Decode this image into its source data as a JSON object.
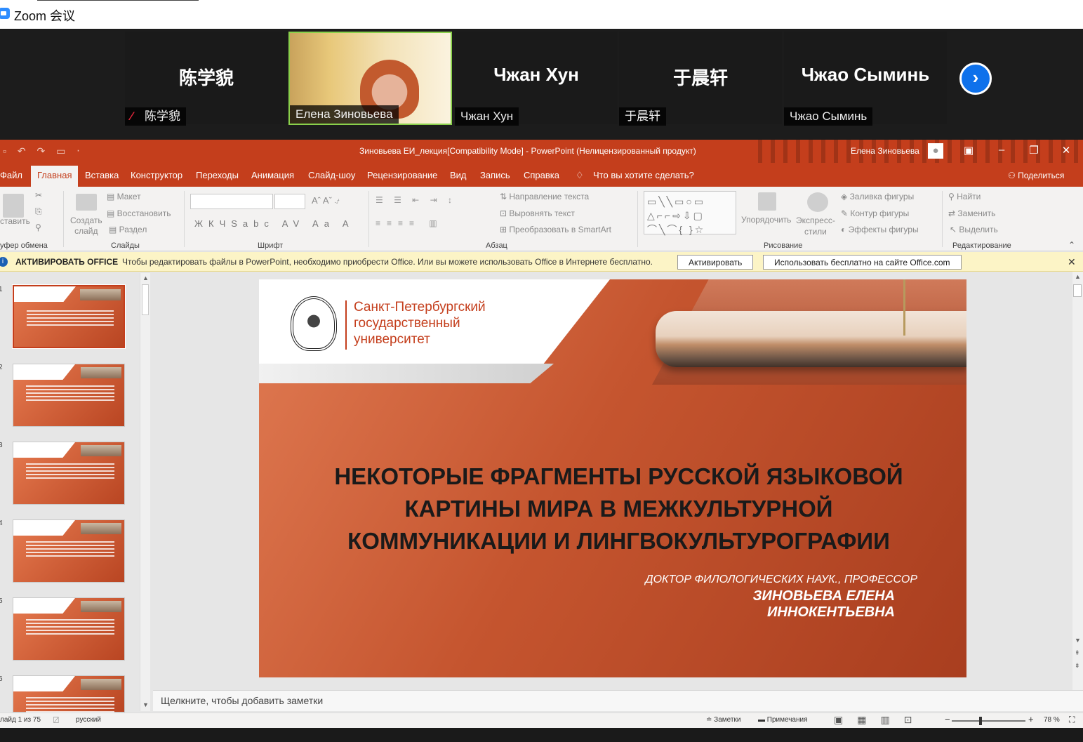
{
  "zoom": {
    "title": "Zoom 会议",
    "participants": [
      {
        "big": "陈学貌",
        "name": "陈学貌",
        "muted": true
      },
      {
        "big": "",
        "name": "Елена Зиновьева",
        "video": true
      },
      {
        "big": "Чжан Хун",
        "name": "Чжан Хун"
      },
      {
        "big": "于晨轩",
        "name": "于晨轩"
      },
      {
        "big": "Чжао Сыминь",
        "name": "Чжао Сыминь"
      }
    ],
    "next_icon": "›"
  },
  "ppt": {
    "doc_title": "Зиновьева ЕИ_лекция[Compatibility Mode]  -  PowerPoint (Нелицензированный продукт)",
    "user": "Елена Зиновьева",
    "tabs": [
      "Файл",
      "Главная",
      "Вставка",
      "Конструктор",
      "Переходы",
      "Анимация",
      "Слайд-шоу",
      "Рецензирование",
      "Вид",
      "Запись",
      "Справка",
      "Что вы хотите сделать?"
    ],
    "share": "Поделиться",
    "ribbon": {
      "paste": "ставить",
      "create_slide": "Создать\nслайд",
      "maket": "Макет",
      "restore": "Восстановить",
      "section": "Раздел",
      "text_dir": "Направление текста",
      "align_text": "Выровнять текст",
      "smartart": "Преобразовать в SmartArt",
      "arrange": "Упорядочить",
      "express": "Экспресс-\nстили",
      "fill": "Заливка фигуры",
      "outline": "Контур фигуры",
      "effects": "Эффекты фигуры",
      "find": "Найти",
      "replace": "Заменить",
      "select": "Выделить",
      "groups": [
        "уфер обмена",
        "Слайды",
        "Шрифт",
        "Абзац",
        "Рисование",
        "Редактирование"
      ]
    },
    "message": {
      "heading": "АКТИВИРОВАТЬ OFFICE",
      "text": "Чтобы редактировать файлы в PowerPoint, необходимо приобрести Office. Или вы можете использовать Office в Интернете бесплатно.",
      "activate": "Активировать",
      "free": "Использовать бесплатно на сайте Office.com"
    },
    "slide": {
      "university": [
        "Санкт-Петербургский",
        "государственный",
        "университет"
      ],
      "title_lines": [
        "НЕКОТОРЫЕ ФРАГМЕНТЫ РУССКОЙ ЯЗЫКОВОЙ",
        "КАРТИНЫ МИРА В МЕЖКУЛЬТУРНОЙ",
        "КОММУНИКАЦИИ И ЛИНГВОКУЛЬТУРОГРАФИИ"
      ],
      "degree": "ДОКТОР ФИЛОЛОГИЧЕСКИХ НАУК., ПРОФЕССОР",
      "author": "ЗИНОВЬЕВА ЕЛЕНА ИННОКЕНТЬЕВНА"
    },
    "notes_placeholder": "Щелкните, чтобы добавить заметки",
    "status": {
      "slide_count": "лайд 1 из 75",
      "language": "русский",
      "notes": "Заметки",
      "comments": "Примечания",
      "zoom": "78 %"
    }
  }
}
